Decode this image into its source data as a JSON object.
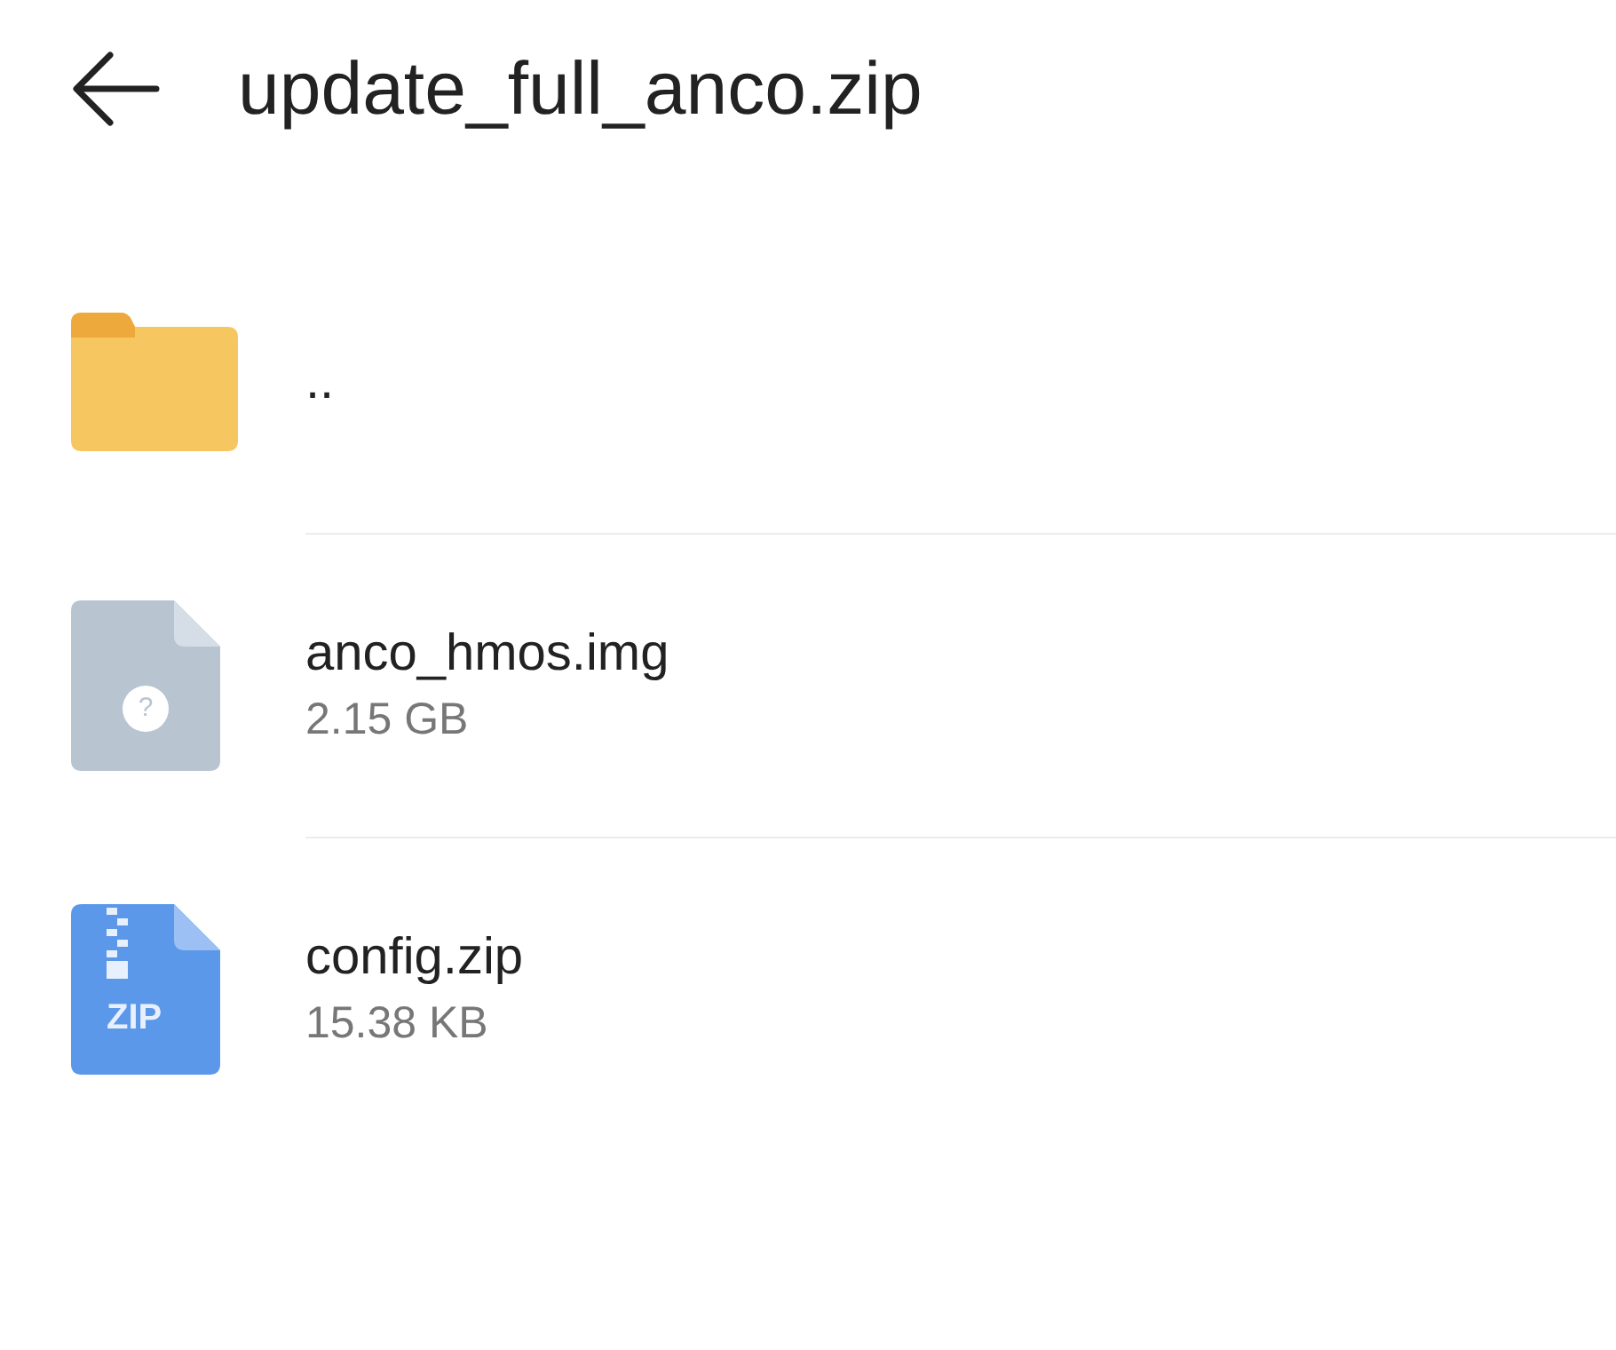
{
  "header": {
    "title": "update_full_anco.zip"
  },
  "files": [
    {
      "kind": "folder",
      "name": ".."
    },
    {
      "kind": "unknown",
      "name": "anco_hmos.img",
      "size": "2.15 GB",
      "icon_text": "?"
    },
    {
      "kind": "zip",
      "name": "config.zip",
      "size": "15.38 KB",
      "icon_text": "ZIP"
    }
  ]
}
